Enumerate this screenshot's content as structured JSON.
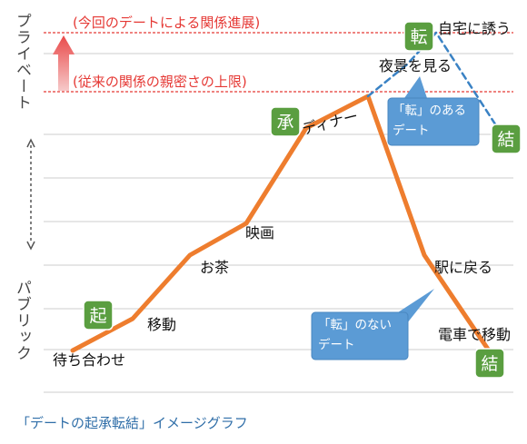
{
  "chart_data": {
    "type": "line",
    "title": "",
    "xlabel": "",
    "ylabel_top": "プライベート",
    "ylabel_bottom": "パブリック",
    "reference_lines": [
      {
        "label": "(今回のデートによる関係進展)",
        "color": "#e53935"
      },
      {
        "label": "(従来の関係の親密さの上限)",
        "color": "#e53935"
      }
    ],
    "series": [
      {
        "style": "solid",
        "color": "#ee7d2e",
        "points": [
          {
            "label": "待ち合わせ",
            "y": 1
          },
          {
            "label": "移動",
            "y": 2
          },
          {
            "label": "お茶",
            "y": 4
          },
          {
            "label": "映画",
            "y": 5
          },
          {
            "label": "ディナー",
            "y": 8
          },
          {
            "label": "",
            "y": 9
          },
          {
            "label": "駅に戻る",
            "y": 4
          },
          {
            "label": "電車で移動",
            "y": 1
          }
        ]
      },
      {
        "style": "dashed",
        "color": "#3a82c4",
        "points": [
          {
            "label": "",
            "y": 9
          },
          {
            "label": "夜景を見る",
            "y": 10
          },
          {
            "label": "自宅に誘う",
            "y": 11
          },
          {
            "label": "",
            "y": 8
          }
        ]
      }
    ],
    "stage_badges": [
      "起",
      "承",
      "転",
      "結",
      "結"
    ],
    "callouts": [
      {
        "lines": [
          "「転」のある",
          "デート"
        ]
      },
      {
        "lines": [
          "「転」のない",
          "デート"
        ]
      }
    ],
    "colors": {
      "badge_fill": "#5a9e40",
      "callout_fill": "#5b9bd5",
      "grid": "#cccccc"
    }
  },
  "caption": "「デートの起承転結」イメージグラフ"
}
